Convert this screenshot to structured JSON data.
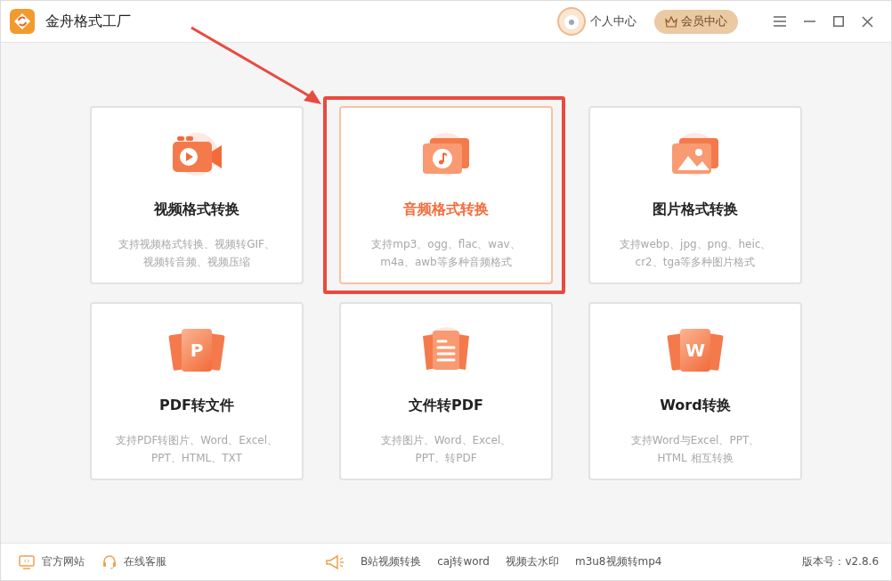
{
  "app": {
    "title": "金舟格式工厂"
  },
  "header": {
    "profile": "个人中心",
    "vip": "会员中心"
  },
  "cards": [
    {
      "kind": "video",
      "title": "视频格式转换",
      "lines": [
        "支持视频格式转换、视频转GIF、",
        "视频转音频、视频压缩"
      ],
      "selected": false,
      "highlighted": false
    },
    {
      "kind": "audio",
      "title": "音频格式转换",
      "lines": [
        "支持mp3、ogg、flac、wav、",
        "m4a、awb等多种音频格式"
      ],
      "selected": true,
      "highlighted": true
    },
    {
      "kind": "image",
      "title": "图片格式转换",
      "lines": [
        "支持webp、jpg、png、heic、",
        "cr2、tga等多种图片格式"
      ],
      "selected": false,
      "highlighted": false
    },
    {
      "kind": "letter",
      "letter": "P",
      "title": "PDF转文件",
      "lines": [
        "支持PDF转图片、Word、Excel、",
        "PPT、HTML、TXT"
      ],
      "selected": false,
      "highlighted": false
    },
    {
      "kind": "doc",
      "title": "文件转PDF",
      "lines": [
        "支持图片、Word、Excel、",
        "PPT、转PDF"
      ],
      "selected": false,
      "highlighted": false
    },
    {
      "kind": "letter",
      "letter": "W",
      "title": "Word转换",
      "lines": [
        "支持Word与Excel、PPT、",
        "HTML 相互转换"
      ],
      "selected": false,
      "highlighted": false
    }
  ],
  "footer": {
    "left": [
      {
        "kind": "web",
        "label": "官方网站"
      },
      {
        "kind": "service",
        "label": "在线客服"
      }
    ],
    "links": [
      "B站视频转换",
      "caj转word",
      "视频去水印",
      "m3u8视频转mp4"
    ],
    "version": "版本号：v2.8.6"
  }
}
